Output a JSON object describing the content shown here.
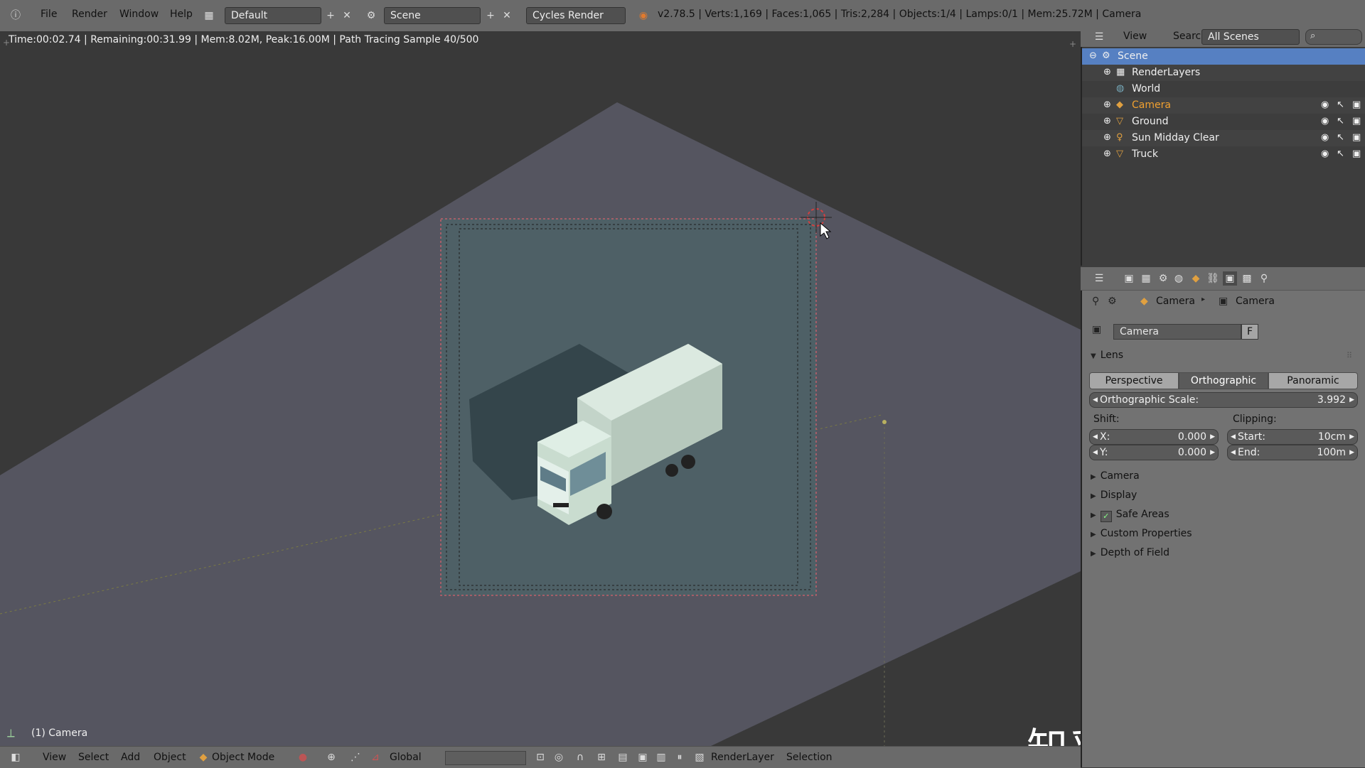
{
  "menu": {
    "file": "File",
    "render": "Render",
    "window": "Window",
    "help": "Help"
  },
  "layout": {
    "screen": "Default",
    "scene": "Scene",
    "engine": "Cycles Render"
  },
  "stats": "v2.78.5 | Verts:1,169 | Faces:1,065 | Tris:2,284 | Objects:1/4 | Lamps:0/1 | Mem:25.72M | Camera",
  "viewport": {
    "render_status": "Time:00:02.74 | Remaining:00:31.99 | Mem:8.02M, Peak:16.00M | Path Tracing Sample 40/500",
    "object_label": "(1) Camera"
  },
  "bottom": {
    "view": "View",
    "select": "Select",
    "add": "Add",
    "object": "Object",
    "mode": "Object Mode",
    "orientation": "Global",
    "render_layer": "RenderLayer",
    "selection": "Selection"
  },
  "outliner": {
    "view": "View",
    "search": "Search",
    "filter": "All Scenes",
    "items": [
      {
        "label": "Scene"
      },
      {
        "label": "RenderLayers"
      },
      {
        "label": "World"
      },
      {
        "label": "Camera"
      },
      {
        "label": "Ground"
      },
      {
        "label": "Sun Midday Clear"
      },
      {
        "label": "Truck"
      }
    ]
  },
  "properties": {
    "breadcrumb_object": "Camera",
    "breadcrumb_data": "Camera",
    "datablock_name": "Camera",
    "fake_user": "F",
    "lens_panel": "Lens",
    "lens_types": [
      "Perspective",
      "Orthographic",
      "Panoramic"
    ],
    "active_lens": "Orthographic",
    "ortho_scale_label": "Orthographic Scale:",
    "ortho_scale_value": "3.992",
    "shift_label": "Shift:",
    "shift_x_label": "X:",
    "shift_x": "0.000",
    "shift_y_label": "Y:",
    "shift_y": "0.000",
    "clipping_label": "Clipping:",
    "clip_start_label": "Start:",
    "clip_start": "10cm",
    "clip_end_label": "End:",
    "clip_end": "100m",
    "panels": [
      "Camera",
      "Display",
      "Safe Areas",
      "Custom Properties",
      "Depth of Field"
    ]
  },
  "watermark": "知乎 @CG Prism",
  "colors": {
    "accent": "#5680c2",
    "viewport_bg": "#393939",
    "grid_plane": "#585862",
    "camera_fill": "#4e6066",
    "truck_body": "#cfe0d6"
  }
}
